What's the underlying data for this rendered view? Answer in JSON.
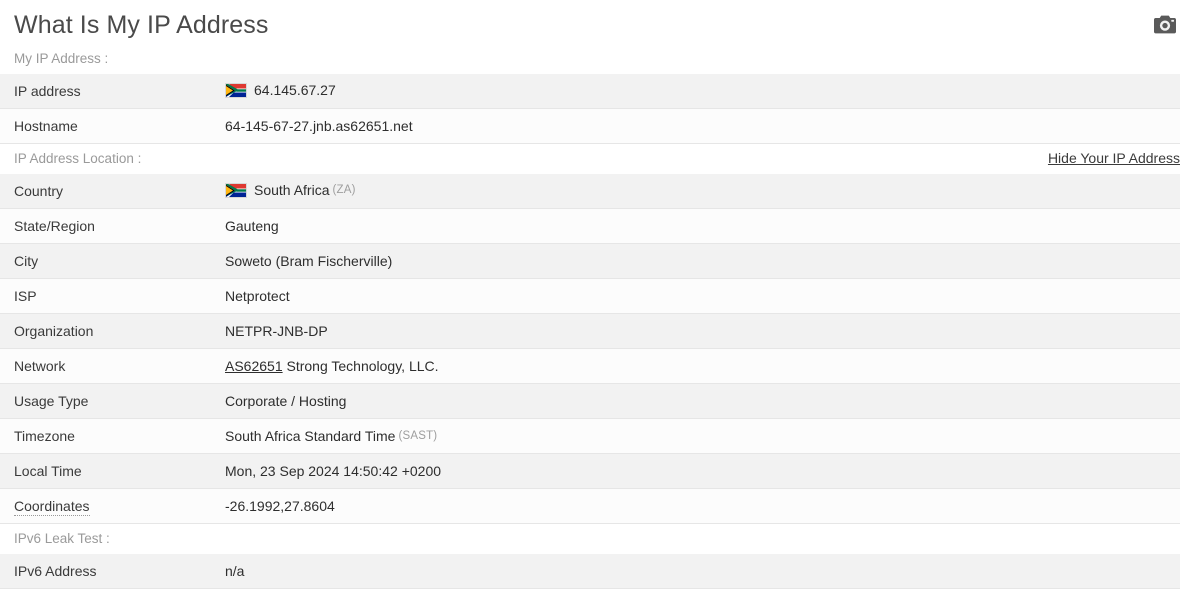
{
  "header": {
    "title": "What Is My IP Address",
    "camera_icon": "camera-icon"
  },
  "sections": [
    {
      "label": "My IP Address :",
      "link": null,
      "rows": [
        {
          "label": "IP address",
          "value": "64.145.67.27",
          "flag": "south-africa-flag",
          "suffix": null,
          "link_prefix": null
        },
        {
          "label": "Hostname",
          "value": "64-145-67-27.jnb.as62651.net",
          "flag": null,
          "suffix": null,
          "link_prefix": null
        }
      ]
    },
    {
      "label": "IP Address Location :",
      "link": "Hide Your IP Address",
      "rows": [
        {
          "label": "Country",
          "value": "South Africa",
          "flag": "south-africa-flag",
          "suffix": "(ZA)",
          "link_prefix": null
        },
        {
          "label": "State/Region",
          "value": "Gauteng",
          "flag": null,
          "suffix": null,
          "link_prefix": null
        },
        {
          "label": "City",
          "value": "Soweto (Bram Fischerville)",
          "flag": null,
          "suffix": null,
          "link_prefix": null
        },
        {
          "label": "ISP",
          "value": "Netprotect",
          "flag": null,
          "suffix": null,
          "link_prefix": null
        },
        {
          "label": "Organization",
          "value": "NETPR-JNB-DP",
          "flag": null,
          "suffix": null,
          "link_prefix": null
        },
        {
          "label": "Network",
          "value": "Strong Technology, LLC.",
          "flag": null,
          "suffix": null,
          "link_prefix": "AS62651"
        },
        {
          "label": "Usage Type",
          "value": "Corporate / Hosting",
          "flag": null,
          "suffix": null,
          "link_prefix": null
        },
        {
          "label": "Timezone",
          "value": "South Africa Standard Time",
          "flag": null,
          "suffix": "(SAST)",
          "link_prefix": null
        },
        {
          "label": "Local Time",
          "value": "Mon, 23 Sep 2024 14:50:42 +0200",
          "flag": null,
          "suffix": null,
          "link_prefix": null
        },
        {
          "label": "Coordinates",
          "value": "-26.1992,27.8604",
          "flag": null,
          "suffix": null,
          "link_prefix": null,
          "label_dotted": true
        }
      ]
    },
    {
      "label": "IPv6 Leak Test :",
      "link": null,
      "rows": [
        {
          "label": "IPv6 Address",
          "value": "n/a",
          "flag": null,
          "suffix": null,
          "link_prefix": null
        }
      ]
    }
  ],
  "colors": {
    "row_odd": "#f2f2f2",
    "row_even": "#fcfcfc",
    "title": "#4a4a4a",
    "section_label": "#9a9a9a",
    "text": "#2e2e2e",
    "flag_red": "#de3831",
    "flag_blue": "#002395",
    "flag_green": "#007a4d",
    "flag_gold": "#ffb612",
    "flag_black": "#000000"
  }
}
